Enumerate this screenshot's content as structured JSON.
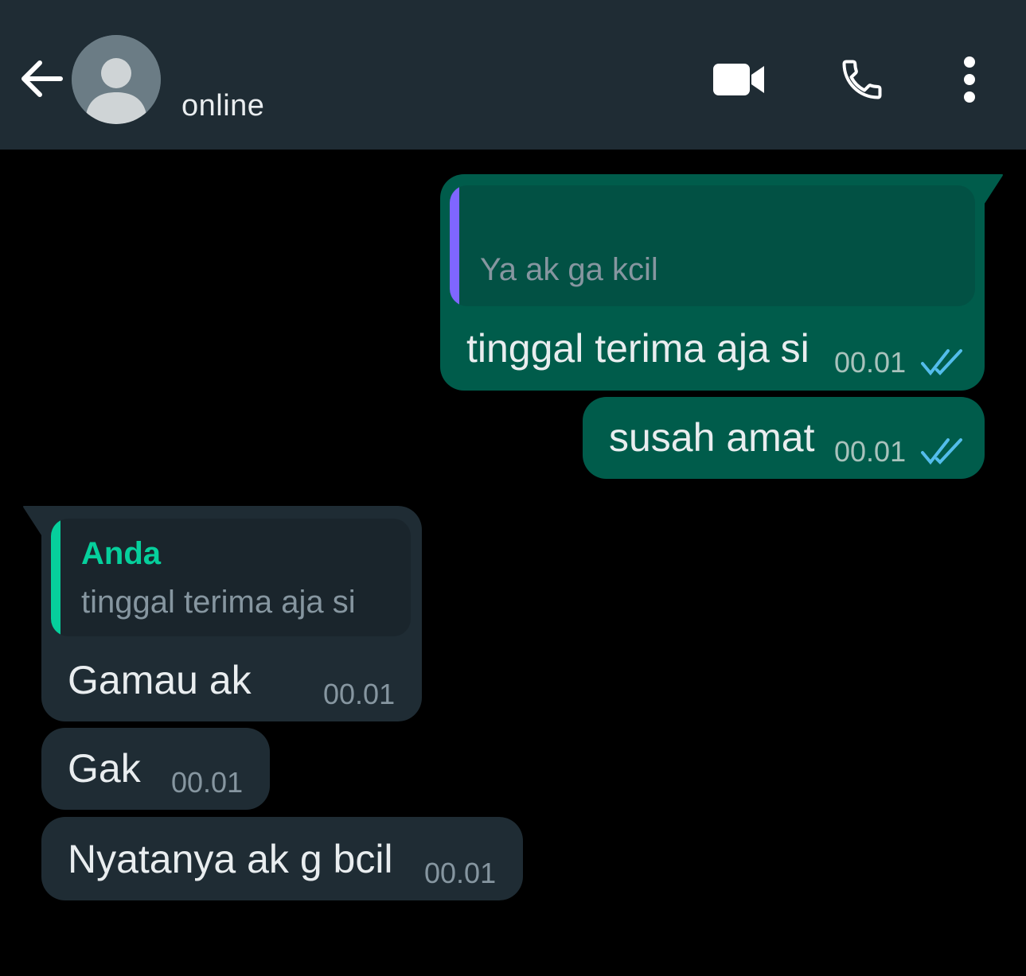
{
  "header": {
    "status": "online",
    "icons": {
      "back": "arrow-left-icon",
      "avatar": "default-avatar-icon",
      "video": "video-call-icon",
      "call": "phone-icon",
      "menu": "more-vertical-icon"
    }
  },
  "colors": {
    "header_bg": "#1f2c34",
    "chat_bg": "#000000",
    "outgoing_bubble": "#005c4b",
    "incoming_bubble": "#1f2c34",
    "read_ticks": "#53bdeb",
    "quote_accent_outgoing": "#7f66ff",
    "quote_accent_incoming": "#06cf9c"
  },
  "messages": [
    {
      "direction": "outgoing",
      "quote": {
        "author": "",
        "text": "Ya ak ga kcil"
      },
      "text": "tinggal terima aja si",
      "time": "00.01",
      "status": "read"
    },
    {
      "direction": "outgoing",
      "text": "susah amat",
      "time": "00.01",
      "status": "read"
    },
    {
      "direction": "incoming",
      "quote": {
        "author": "Anda",
        "text": "tinggal terima aja si"
      },
      "text": "Gamau ak",
      "time": "00.01"
    },
    {
      "direction": "incoming",
      "text": "Gak",
      "time": "00.01"
    },
    {
      "direction": "incoming",
      "text": "Nyatanya ak g bcil",
      "time": "00.01"
    }
  ]
}
